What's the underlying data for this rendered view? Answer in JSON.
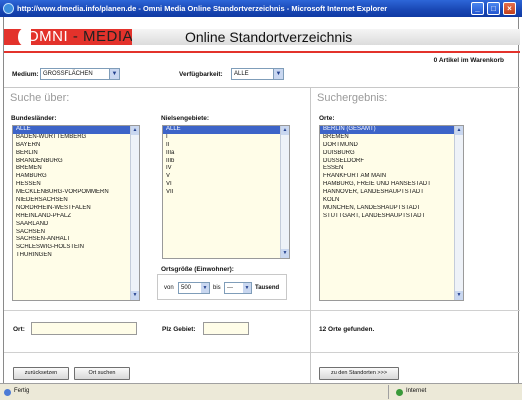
{
  "window": {
    "title": "http://www.dmedia.info/planen.de - Omni Media Online Standortverzeichnis - Microsoft Internet Explorer",
    "controls": {
      "minimize": "_",
      "maximize": "□",
      "close": "×"
    }
  },
  "header": {
    "logo_omni": "OMNI",
    "logo_media": " - MEDIA",
    "title": "Online Standortverzeichnis",
    "count_text": "0 Artikel im Warenkorb"
  },
  "filters": {
    "medium_label": "Medium:",
    "medium_value": "GROSSFLÄCHEN",
    "verfuegbarkeit_label": "Verfügbarkeit:",
    "verfuegbarkeit_value": "ALLE"
  },
  "search": {
    "title": "Suche über:",
    "bundeslaender_label": "Bundesländer:",
    "bundeslaender": [
      "ALLE",
      "BADEN-WÜRTTEMBERG",
      "BAYERN",
      "BERLIN",
      "BRANDENBURG",
      "BREMEN",
      "HAMBURG",
      "HESSEN",
      "MECKLENBURG-VORPOMMERN",
      "NIEDERSACHSEN",
      "NORDRHEIN-WESTFALEN",
      "RHEINLAND-PFALZ",
      "SAARLAND",
      "SACHSEN",
      "SACHSEN-ANHALT",
      "SCHLESWIG-HOLSTEIN",
      "THÜRINGEN"
    ],
    "nielsen_label": "Nielsengebiete:",
    "nielsen": [
      "ALLE",
      "I",
      "II",
      "IIIa",
      "IIIb",
      "IV",
      "V",
      "VI",
      "VII"
    ],
    "ortsgroesse_label": "Ortsgröße (Einwohner):",
    "von_label": "von",
    "von_value": "500",
    "bis_label": "bis",
    "bis_value": "---",
    "tausend_label": "Tausend",
    "ort_label": "Ort:",
    "plz_label": "Plz Gebiet:",
    "reset_button": "zurücksetzen",
    "search_button": "Ort suchen"
  },
  "results": {
    "title": "Suchergebnis:",
    "orte_label": "Orte:",
    "orte": [
      "BERLIN (GESAMT)",
      "BREMEN",
      "DORTMUND",
      "DUISBURG",
      "DÜSSELDORF",
      "ESSEN",
      "FRANKFURT AM MAIN",
      "HAMBURG, FREIE UND HANSESTADT",
      "HANNOVER, LANDESHAUPTSTADT",
      "KÖLN",
      "MÜNCHEN, LANDESHAUPTSTADT",
      "STUTTGART, LANDESHAUPTSTADT"
    ],
    "found_text": "12 Orte gefunden.",
    "to_locations_button": "zu den Standorten >>>"
  },
  "statusbar": {
    "left": "Fertig",
    "zone": "Internet"
  },
  "colors": {
    "brand_red": "#e3322b",
    "selection_blue": "#3d64c8",
    "list_background": "#fffde8"
  }
}
